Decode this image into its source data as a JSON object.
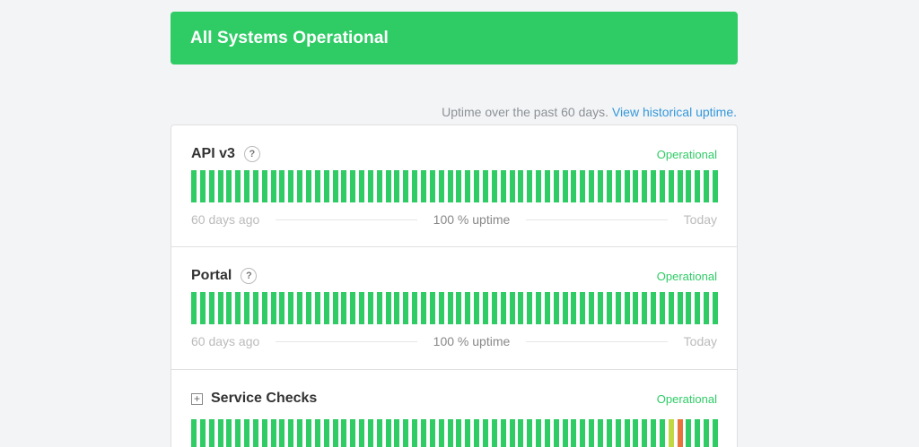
{
  "banner": {
    "text": "All Systems Operational"
  },
  "uptime_note": {
    "text": "Uptime over the past 60 days.",
    "link": "View historical uptime."
  },
  "colors": {
    "operational": "#2fcc66",
    "degraded": "#c1d843",
    "outage": "#e8743b"
  },
  "components": [
    {
      "name": "API v3",
      "status": "Operational",
      "has_help": true,
      "range_start": "60 days ago",
      "uptime": "100 % uptime",
      "range_end": "Today",
      "days": [
        "ok",
        "ok",
        "ok",
        "ok",
        "ok",
        "ok",
        "ok",
        "ok",
        "ok",
        "ok",
        "ok",
        "ok",
        "ok",
        "ok",
        "ok",
        "ok",
        "ok",
        "ok",
        "ok",
        "ok",
        "ok",
        "ok",
        "ok",
        "ok",
        "ok",
        "ok",
        "ok",
        "ok",
        "ok",
        "ok",
        "ok",
        "ok",
        "ok",
        "ok",
        "ok",
        "ok",
        "ok",
        "ok",
        "ok",
        "ok",
        "ok",
        "ok",
        "ok",
        "ok",
        "ok",
        "ok",
        "ok",
        "ok",
        "ok",
        "ok",
        "ok",
        "ok",
        "ok",
        "ok",
        "ok",
        "ok",
        "ok",
        "ok",
        "ok",
        "ok"
      ]
    },
    {
      "name": "Portal",
      "status": "Operational",
      "has_help": true,
      "range_start": "60 days ago",
      "uptime": "100 % uptime",
      "range_end": "Today",
      "days": [
        "ok",
        "ok",
        "ok",
        "ok",
        "ok",
        "ok",
        "ok",
        "ok",
        "ok",
        "ok",
        "ok",
        "ok",
        "ok",
        "ok",
        "ok",
        "ok",
        "ok",
        "ok",
        "ok",
        "ok",
        "ok",
        "ok",
        "ok",
        "ok",
        "ok",
        "ok",
        "ok",
        "ok",
        "ok",
        "ok",
        "ok",
        "ok",
        "ok",
        "ok",
        "ok",
        "ok",
        "ok",
        "ok",
        "ok",
        "ok",
        "ok",
        "ok",
        "ok",
        "ok",
        "ok",
        "ok",
        "ok",
        "ok",
        "ok",
        "ok",
        "ok",
        "ok",
        "ok",
        "ok",
        "ok",
        "ok",
        "ok",
        "ok",
        "ok",
        "ok"
      ]
    },
    {
      "name": "Service Checks",
      "status": "Operational",
      "has_help": false,
      "days": [
        "ok",
        "ok",
        "ok",
        "ok",
        "ok",
        "ok",
        "ok",
        "ok",
        "ok",
        "ok",
        "ok",
        "ok",
        "ok",
        "ok",
        "ok",
        "ok",
        "ok",
        "ok",
        "ok",
        "ok",
        "ok",
        "ok",
        "ok",
        "ok",
        "ok",
        "ok",
        "ok",
        "ok",
        "ok",
        "ok",
        "ok",
        "ok",
        "ok",
        "ok",
        "ok",
        "ok",
        "ok",
        "ok",
        "ok",
        "ok",
        "ok",
        "ok",
        "ok",
        "ok",
        "ok",
        "ok",
        "ok",
        "ok",
        "ok",
        "ok",
        "ok",
        "ok",
        "ok",
        "ok",
        "degraded",
        "outage",
        "ok",
        "ok",
        "ok",
        "ok"
      ]
    }
  ]
}
